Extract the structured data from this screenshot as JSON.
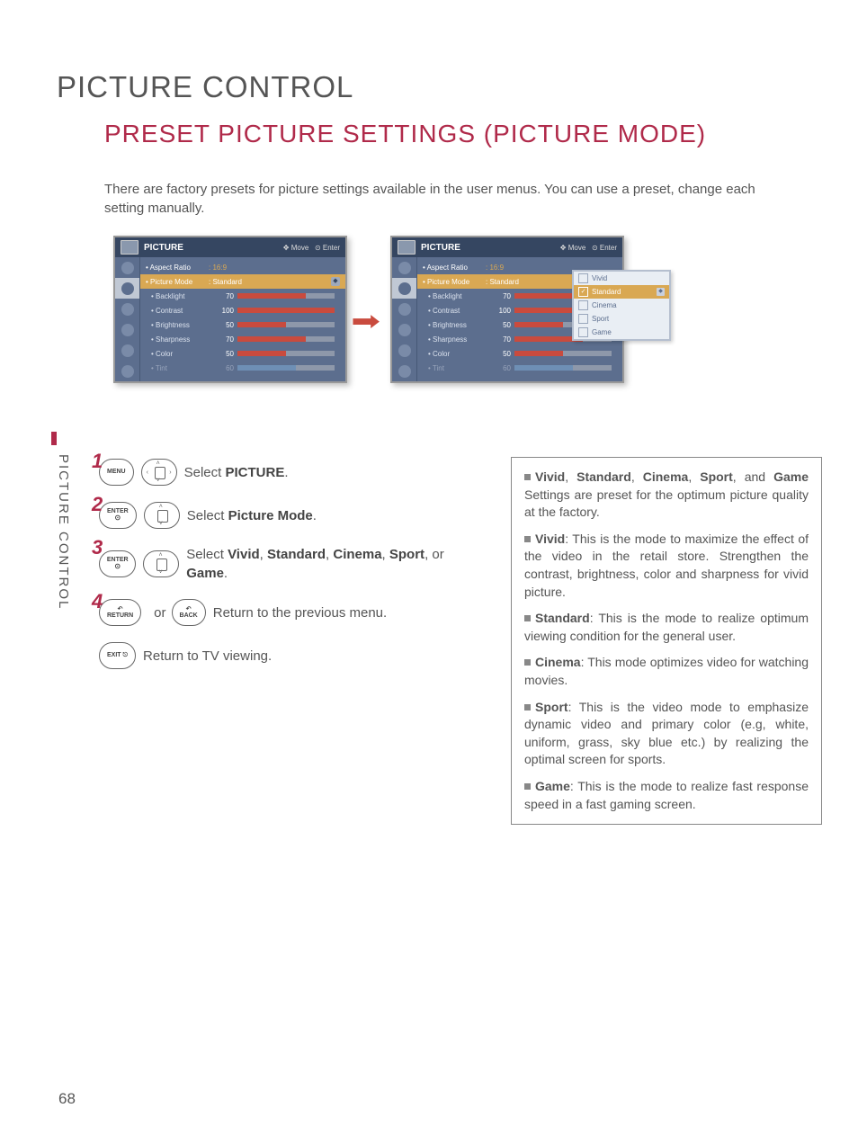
{
  "page_title": "PICTURE CONTROL",
  "section_title": "PRESET PICTURE SETTINGS (PICTURE MODE)",
  "intro": "There are factory presets for picture settings available in the user menus. You can use a preset, change each setting manually.",
  "side_tab": "PICTURE CONTROL",
  "page_number": "68",
  "osd": {
    "header_title": "PICTURE",
    "hints_move": "Move",
    "hints_enter": "Enter",
    "aspect_label": "• Aspect Ratio",
    "aspect_value": ": 16:9",
    "mode_label": "• Picture Mode",
    "mode_value": ": Standard",
    "params": [
      {
        "label": "• Backlight",
        "value": "70",
        "fill": 70
      },
      {
        "label": "• Contrast",
        "value": "100",
        "fill": 100
      },
      {
        "label": "• Brightness",
        "value": "50",
        "fill": 50
      },
      {
        "label": "• Sharpness",
        "value": "70",
        "fill": 70
      },
      {
        "label": "• Color",
        "value": "50",
        "fill": 50
      },
      {
        "label": "• Tint",
        "value": "60",
        "fill": 60,
        "dim": true
      }
    ],
    "dropdown": [
      "Vivid",
      "Standard",
      "Cinema",
      "Sport",
      "Game"
    ],
    "dropdown_selected": 1
  },
  "steps": [
    {
      "num": "1",
      "buttons": [
        {
          "label": "MENU"
        },
        {
          "type": "nav4"
        }
      ],
      "text_pre": "Select ",
      "bold": "PICTURE",
      "text_post": "."
    },
    {
      "num": "2",
      "buttons": [
        {
          "label": "ENTER",
          "dot": "⊙"
        },
        {
          "type": "navUD"
        }
      ],
      "text_pre": "Select ",
      "bold": "Picture Mode",
      "text_post": "."
    },
    {
      "num": "3",
      "buttons": [
        {
          "label": "ENTER",
          "dot": "⊙"
        },
        {
          "type": "navUD"
        }
      ],
      "text_html": "Select <b>Vivid</b>,  <b>Standard</b>, <b>Cinema</b>, <b>Sport</b>, or <b>Game</b>."
    },
    {
      "num": "4",
      "buttons": [
        {
          "label": "RETURN",
          "icon": "↶"
        }
      ],
      "or_label": "or",
      "buttons2": [
        {
          "label": "BACK",
          "icon": "↶"
        }
      ],
      "text": "Return to the previous menu."
    },
    {
      "buttons": [
        {
          "label": "EXIT ⎋"
        }
      ],
      "text": "Return to TV viewing."
    }
  ],
  "desc": {
    "p1_pre": "",
    "p1_bold_a": "Vivid",
    "p1_mid_a": ", ",
    "p1_bold_b": "Standard",
    "p1_mid_b": ", ",
    "p1_bold_c": "Cinema",
    "p1_mid_c": ", ",
    "p1_bold_d": "Sport",
    "p1_mid_d": ", and ",
    "p1_bold_e": "Game",
    "p1_post": " Settings are preset for the optimum picture quality at the factory.",
    "p2_bold": "Vivid",
    "p2_text": ": This is the mode to maximize the effect of the video in the retail store. Strengthen the contrast, brightness, color and sharpness for vivid picture.",
    "p3_bold": "Standard",
    "p3_text": ": This is the mode to realize optimum viewing condition for the general user.",
    "p4_bold": "Cinema",
    "p4_text": ": This mode optimizes video for watching movies.",
    "p5_bold": "Sport",
    "p5_text": ": This is the video mode to emphasize dynamic video and primary color (e.g, white, uniform, grass, sky blue etc.) by realizing the optimal screen for sports.",
    "p6_bold": "Game",
    "p6_text": ": This is the mode to realize fast response speed in a fast gaming screen."
  }
}
